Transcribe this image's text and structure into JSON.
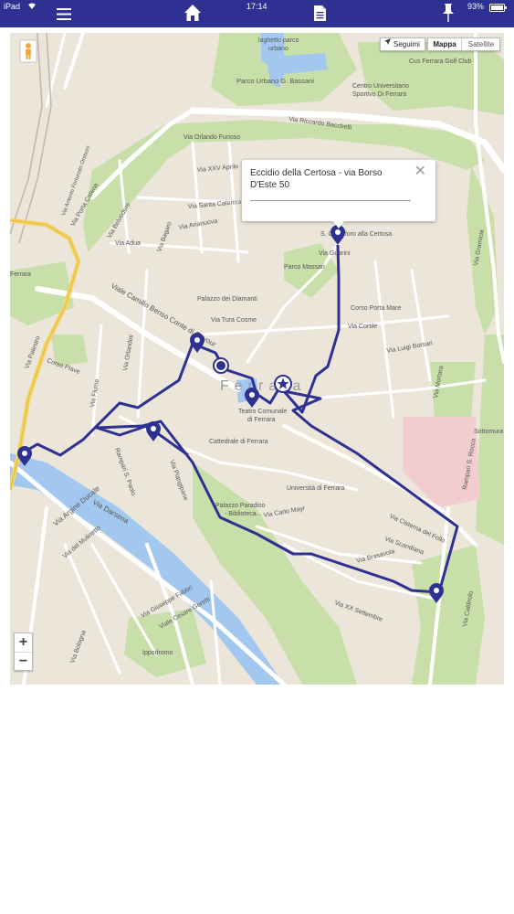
{
  "statusbar": {
    "device": "iPad",
    "time": "17:14",
    "battery": "93%"
  },
  "toolbar": {
    "icons": [
      "menu-icon",
      "home-icon",
      "document-icon",
      "pin-icon"
    ]
  },
  "map": {
    "controls": {
      "follow_label": "Seguimi",
      "map_type_map": "Mappa",
      "map_type_satellite": "Satellite",
      "selected_type": "Mappa"
    },
    "zoom": {
      "in": "+",
      "out": "−"
    },
    "popup": {
      "title": "Eccidio della Certosa - via Borso D'Este 50",
      "close": "✕"
    },
    "city_label": "Ferrara",
    "labels": {
      "l1": "laghetto parco",
      "l2": "urbano",
      "l3": "Parco Urbano G. Bassani",
      "l4": "Centro Universitario",
      "l5": "Sportivo Di Ferrara",
      "l6": "Cus Ferrara Golf Club",
      "l7": "Via Riccardo Bacchelli",
      "l8": "Via Orlando Furioso",
      "l9": "Via XXV Aprile",
      "l10": "Via Santa Caterina",
      "l11": "Via Arianuova",
      "l12": "Via Porta Catena",
      "l13": "Via Antonio Fortunato Orsboni",
      "l14": "Via Belvedere",
      "l15": "Via Adua",
      "l16": "Via Bagaro",
      "l17": "Via Guarini",
      "l18": "Parco Massari",
      "l19": "S. Cristoforo alla Certosa",
      "l20": "Via Gramicia",
      "l21": "Ferrara",
      "l22": "Viale Camillo Benso Conte di Cavour",
      "l23": "Palazzo dei Diamanti",
      "l24": "Via Tura Cosme",
      "l25": "Corso Porta Mare",
      "l26": "Via Cortile",
      "l27": "Via Luigi Borsari",
      "l28": "Teatro Comunale",
      "l29": "di Ferrara",
      "l30": "Cattedrale di Ferrara",
      "l31": "Università di Ferrara",
      "l32": "Palazzo Paradiso",
      "l33": "- Biblioteca...",
      "l34": "Via Darsena",
      "l35": "Via Argine Ducale",
      "l36": "Via del Mulinetto",
      "l37": "Via Cisterna del Follo",
      "l38": "Via Scandiana",
      "l39": "Via Brasavola",
      "l40": "Via XX Settembre",
      "l41": "Via Caldirolo",
      "l42": "Via Giuseppe Fabbri",
      "l43": "Viale Cesare Goretti",
      "l44": "Ippodromo",
      "l45": "Via Bologna",
      "l46": "Via Piangipane",
      "l47": "Via Carlo Mayr",
      "l48": "Sottomura",
      "l49": "Rampari S. Rocco",
      "l50": "Via Mortara",
      "l51": "Corso Piave",
      "l52": "Via Fiume",
      "l53": "Via Palestro",
      "l54": "Rampari S. Paolo",
      "l55": "Via Orlandini"
    },
    "route_stops": 7,
    "colors": {
      "route": "#2e3191",
      "park": "#c8dfa9",
      "water": "#a3c8ef",
      "toolbar": "#2e3191"
    }
  }
}
